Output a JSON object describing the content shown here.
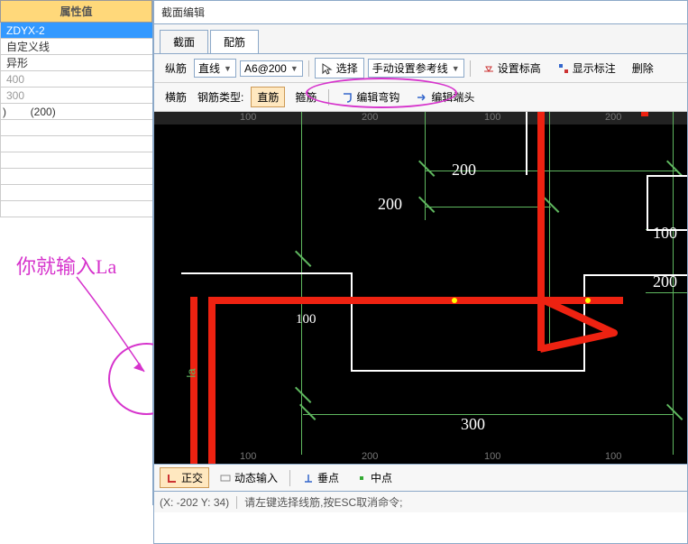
{
  "left": {
    "header": "属性值",
    "rows": [
      "ZDYX-2",
      "自定义线",
      "异形",
      "400",
      "300",
      "(200)"
    ]
  },
  "window_title": "截面编辑",
  "tabs": {
    "a": "截面",
    "b": "配筋"
  },
  "tb1": {
    "lab_zong": "纵筋",
    "sel_line": "直线",
    "sel_size": "A6@200",
    "btn_select": "选择",
    "btn_manual": "手动设置参考线",
    "btn_setelev": "设置标高",
    "btn_showmark": "显示标注",
    "btn_delete": "删除"
  },
  "tb2": {
    "lab_heng": "横筋",
    "lab_type": "钢筋类型:",
    "btn_straight": "直筋",
    "btn_stirrup": "箍筋",
    "btn_edithook": "编辑弯钩",
    "btn_editend": "编辑端头"
  },
  "ruler": {
    "a": "100",
    "b": "200",
    "c": "100",
    "d": "200",
    "e": "100"
  },
  "dims": {
    "d200a": "200",
    "d200b": "200",
    "d100a": "100",
    "d100b": "100",
    "d200c": "200",
    "d300": "300"
  },
  "la_label": "la",
  "bottom": {
    "ortho": "正交",
    "dyn": "动态输入",
    "endpoint": "垂点",
    "mid": "中点"
  },
  "status": {
    "coord": "(X: -202 Y: 34)",
    "hint": "请左键选择线筋,按ESC取消命令;"
  },
  "annotation": "你就输入La"
}
